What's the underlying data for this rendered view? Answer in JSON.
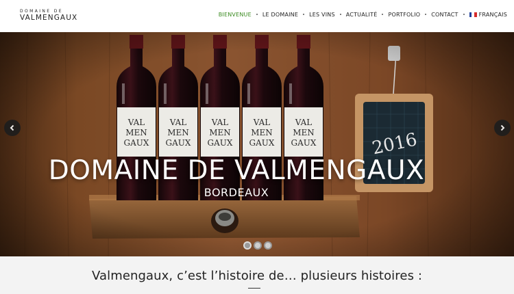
{
  "logo": {
    "top": "DOMAINE DE",
    "main": "VALMENGAUX"
  },
  "nav": {
    "items": [
      {
        "label": "BIENVENUE",
        "active": true
      },
      {
        "label": "LE DOMAINE",
        "active": false
      },
      {
        "label": "LES VINS",
        "active": false
      },
      {
        "label": "ACTUALITÉ",
        "active": false
      },
      {
        "label": "PORTFOLIO",
        "active": false
      },
      {
        "label": "CONTACT",
        "active": false
      }
    ],
    "language": "FRANÇAIS",
    "flag_colors": [
      "#1f3f9a",
      "#ffffff",
      "#d62b2b"
    ],
    "active_color": "#3a8a1f"
  },
  "hero": {
    "title": "DOMAINE DE VALMENGAUX",
    "subtitle": "BORDEAUX",
    "bottle_label": [
      "VAL",
      "MEN",
      "GAUX"
    ],
    "chalkboard_text": "2016",
    "prev_icon": "chevron-left-icon",
    "next_icon": "chevron-right-icon",
    "slide_count": 3,
    "active_slide": 1
  },
  "intro": {
    "heading": "Valmengaux, c’est l’histoire de… plusieurs histoires :"
  }
}
